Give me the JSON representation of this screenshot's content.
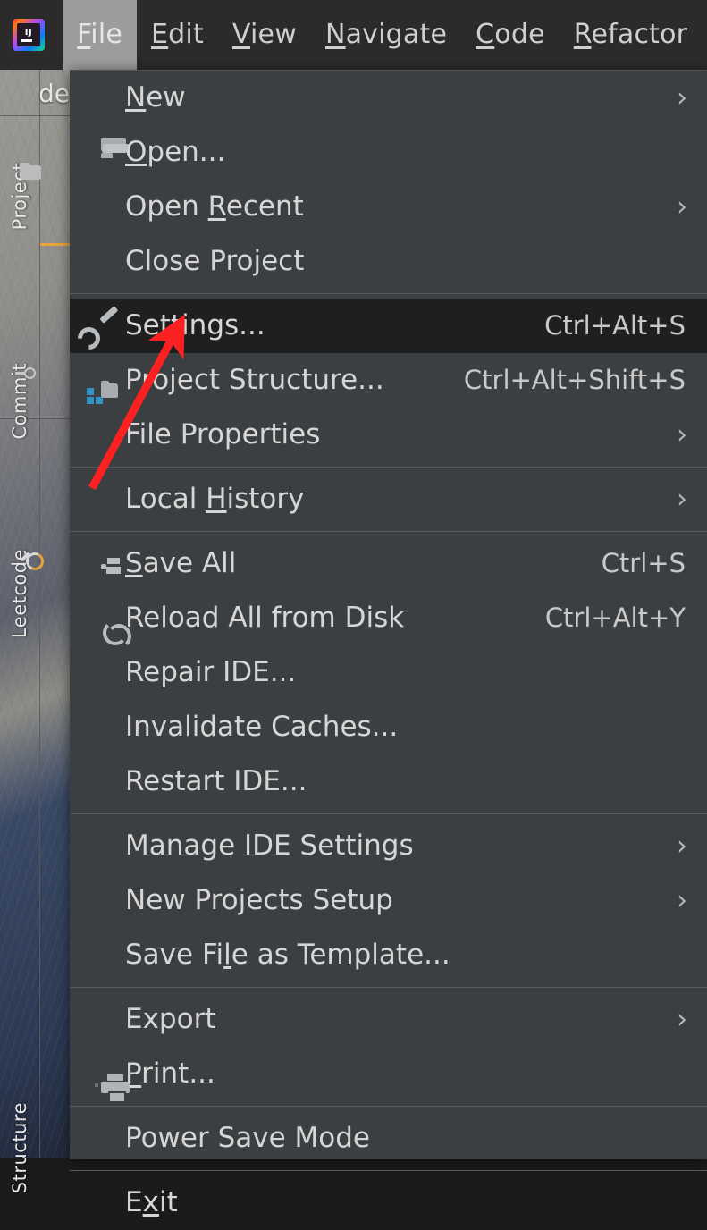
{
  "app": {
    "logo_icon": "intellij-idea-logo",
    "logo_text": "IJ"
  },
  "menubar": {
    "items": [
      {
        "label": "File",
        "mnemonic": "F",
        "active": true
      },
      {
        "label": "Edit",
        "mnemonic": "E",
        "active": false
      },
      {
        "label": "View",
        "mnemonic": "V",
        "active": false
      },
      {
        "label": "Navigate",
        "mnemonic": "N",
        "active": false
      },
      {
        "label": "Code",
        "mnemonic": "C",
        "active": false
      },
      {
        "label": "Refactor",
        "mnemonic": "R",
        "active": false
      }
    ]
  },
  "sidebar": {
    "project_title_partial": "de",
    "items": [
      {
        "label": "Project",
        "icon": "folder-icon"
      },
      {
        "label": "Commit",
        "icon": "commit-icon"
      },
      {
        "label": "Leetcode",
        "icon": "leetcode-icon"
      },
      {
        "label": "Structure",
        "icon": "structure-icon"
      }
    ]
  },
  "file_menu": {
    "title": "File",
    "items": [
      {
        "type": "item",
        "label": "New",
        "mnemonic": "N",
        "icon": null,
        "accel": "",
        "submenu": true,
        "highlight": false
      },
      {
        "type": "item",
        "label": "Open...",
        "mnemonic": "O",
        "icon": "open-folder-icon",
        "accel": "",
        "submenu": false,
        "highlight": false
      },
      {
        "type": "item",
        "label": "Open Recent",
        "mnemonic": "R",
        "icon": null,
        "accel": "",
        "submenu": true,
        "highlight": false
      },
      {
        "type": "item",
        "label": "Close Project",
        "mnemonic": "",
        "icon": null,
        "accel": "",
        "submenu": false,
        "highlight": false
      },
      {
        "type": "separator"
      },
      {
        "type": "item",
        "label": "Settings...",
        "mnemonic": "t",
        "icon": "wrench-icon",
        "accel": "Ctrl+Alt+S",
        "submenu": false,
        "highlight": true
      },
      {
        "type": "item",
        "label": "Project Structure...",
        "mnemonic": "",
        "icon": "project-structure-icon",
        "accel": "Ctrl+Alt+Shift+S",
        "submenu": false,
        "highlight": false
      },
      {
        "type": "item",
        "label": "File Properties",
        "mnemonic": "",
        "icon": null,
        "accel": "",
        "submenu": true,
        "highlight": false
      },
      {
        "type": "separator"
      },
      {
        "type": "item",
        "label": "Local History",
        "mnemonic": "H",
        "icon": null,
        "accel": "",
        "submenu": true,
        "highlight": false
      },
      {
        "type": "separator"
      },
      {
        "type": "item",
        "label": "Save All",
        "mnemonic": "S",
        "icon": "save-icon",
        "accel": "Ctrl+S",
        "submenu": false,
        "highlight": false
      },
      {
        "type": "item",
        "label": "Reload All from Disk",
        "mnemonic": "",
        "icon": "reload-icon",
        "accel": "Ctrl+Alt+Y",
        "submenu": false,
        "highlight": false
      },
      {
        "type": "item",
        "label": "Repair IDE...",
        "mnemonic": "",
        "icon": null,
        "accel": "",
        "submenu": false,
        "highlight": false
      },
      {
        "type": "item",
        "label": "Invalidate Caches...",
        "mnemonic": "",
        "icon": null,
        "accel": "",
        "submenu": false,
        "highlight": false
      },
      {
        "type": "item",
        "label": "Restart IDE...",
        "mnemonic": "",
        "icon": null,
        "accel": "",
        "submenu": false,
        "highlight": false
      },
      {
        "type": "separator"
      },
      {
        "type": "item",
        "label": "Manage IDE Settings",
        "mnemonic": "",
        "icon": null,
        "accel": "",
        "submenu": true,
        "highlight": false
      },
      {
        "type": "item",
        "label": "New Projects Setup",
        "mnemonic": "",
        "icon": null,
        "accel": "",
        "submenu": true,
        "highlight": false
      },
      {
        "type": "item",
        "label": "Save File as Template...",
        "mnemonic": "l",
        "icon": null,
        "accel": "",
        "submenu": false,
        "highlight": false
      },
      {
        "type": "separator"
      },
      {
        "type": "item",
        "label": "Export",
        "mnemonic": "",
        "icon": null,
        "accel": "",
        "submenu": true,
        "highlight": false
      },
      {
        "type": "item",
        "label": "Print...",
        "mnemonic": "P",
        "icon": "printer-icon",
        "accel": "",
        "submenu": false,
        "highlight": false
      },
      {
        "type": "separator"
      },
      {
        "type": "item",
        "label": "Power Save Mode",
        "mnemonic": "",
        "icon": null,
        "accel": "",
        "submenu": false,
        "highlight": false
      },
      {
        "type": "separator"
      },
      {
        "type": "item",
        "label": "Exit",
        "mnemonic": "x",
        "icon": null,
        "accel": "",
        "submenu": false,
        "highlight": false
      }
    ]
  },
  "annotation": {
    "type": "arrow",
    "color": "#fc2121",
    "points_at": "Settings..."
  },
  "colors": {
    "menu_bg": "#3c3f41",
    "menu_highlight_bg": "#1f1f1f",
    "menubar_bg": "#2b2b2b",
    "menubar_active_bg": "#9c9c9c",
    "text": "#d6d6d6",
    "separator": "#555a5c",
    "accent_orange": "#e8a33d",
    "annotation_red": "#fc2121"
  }
}
